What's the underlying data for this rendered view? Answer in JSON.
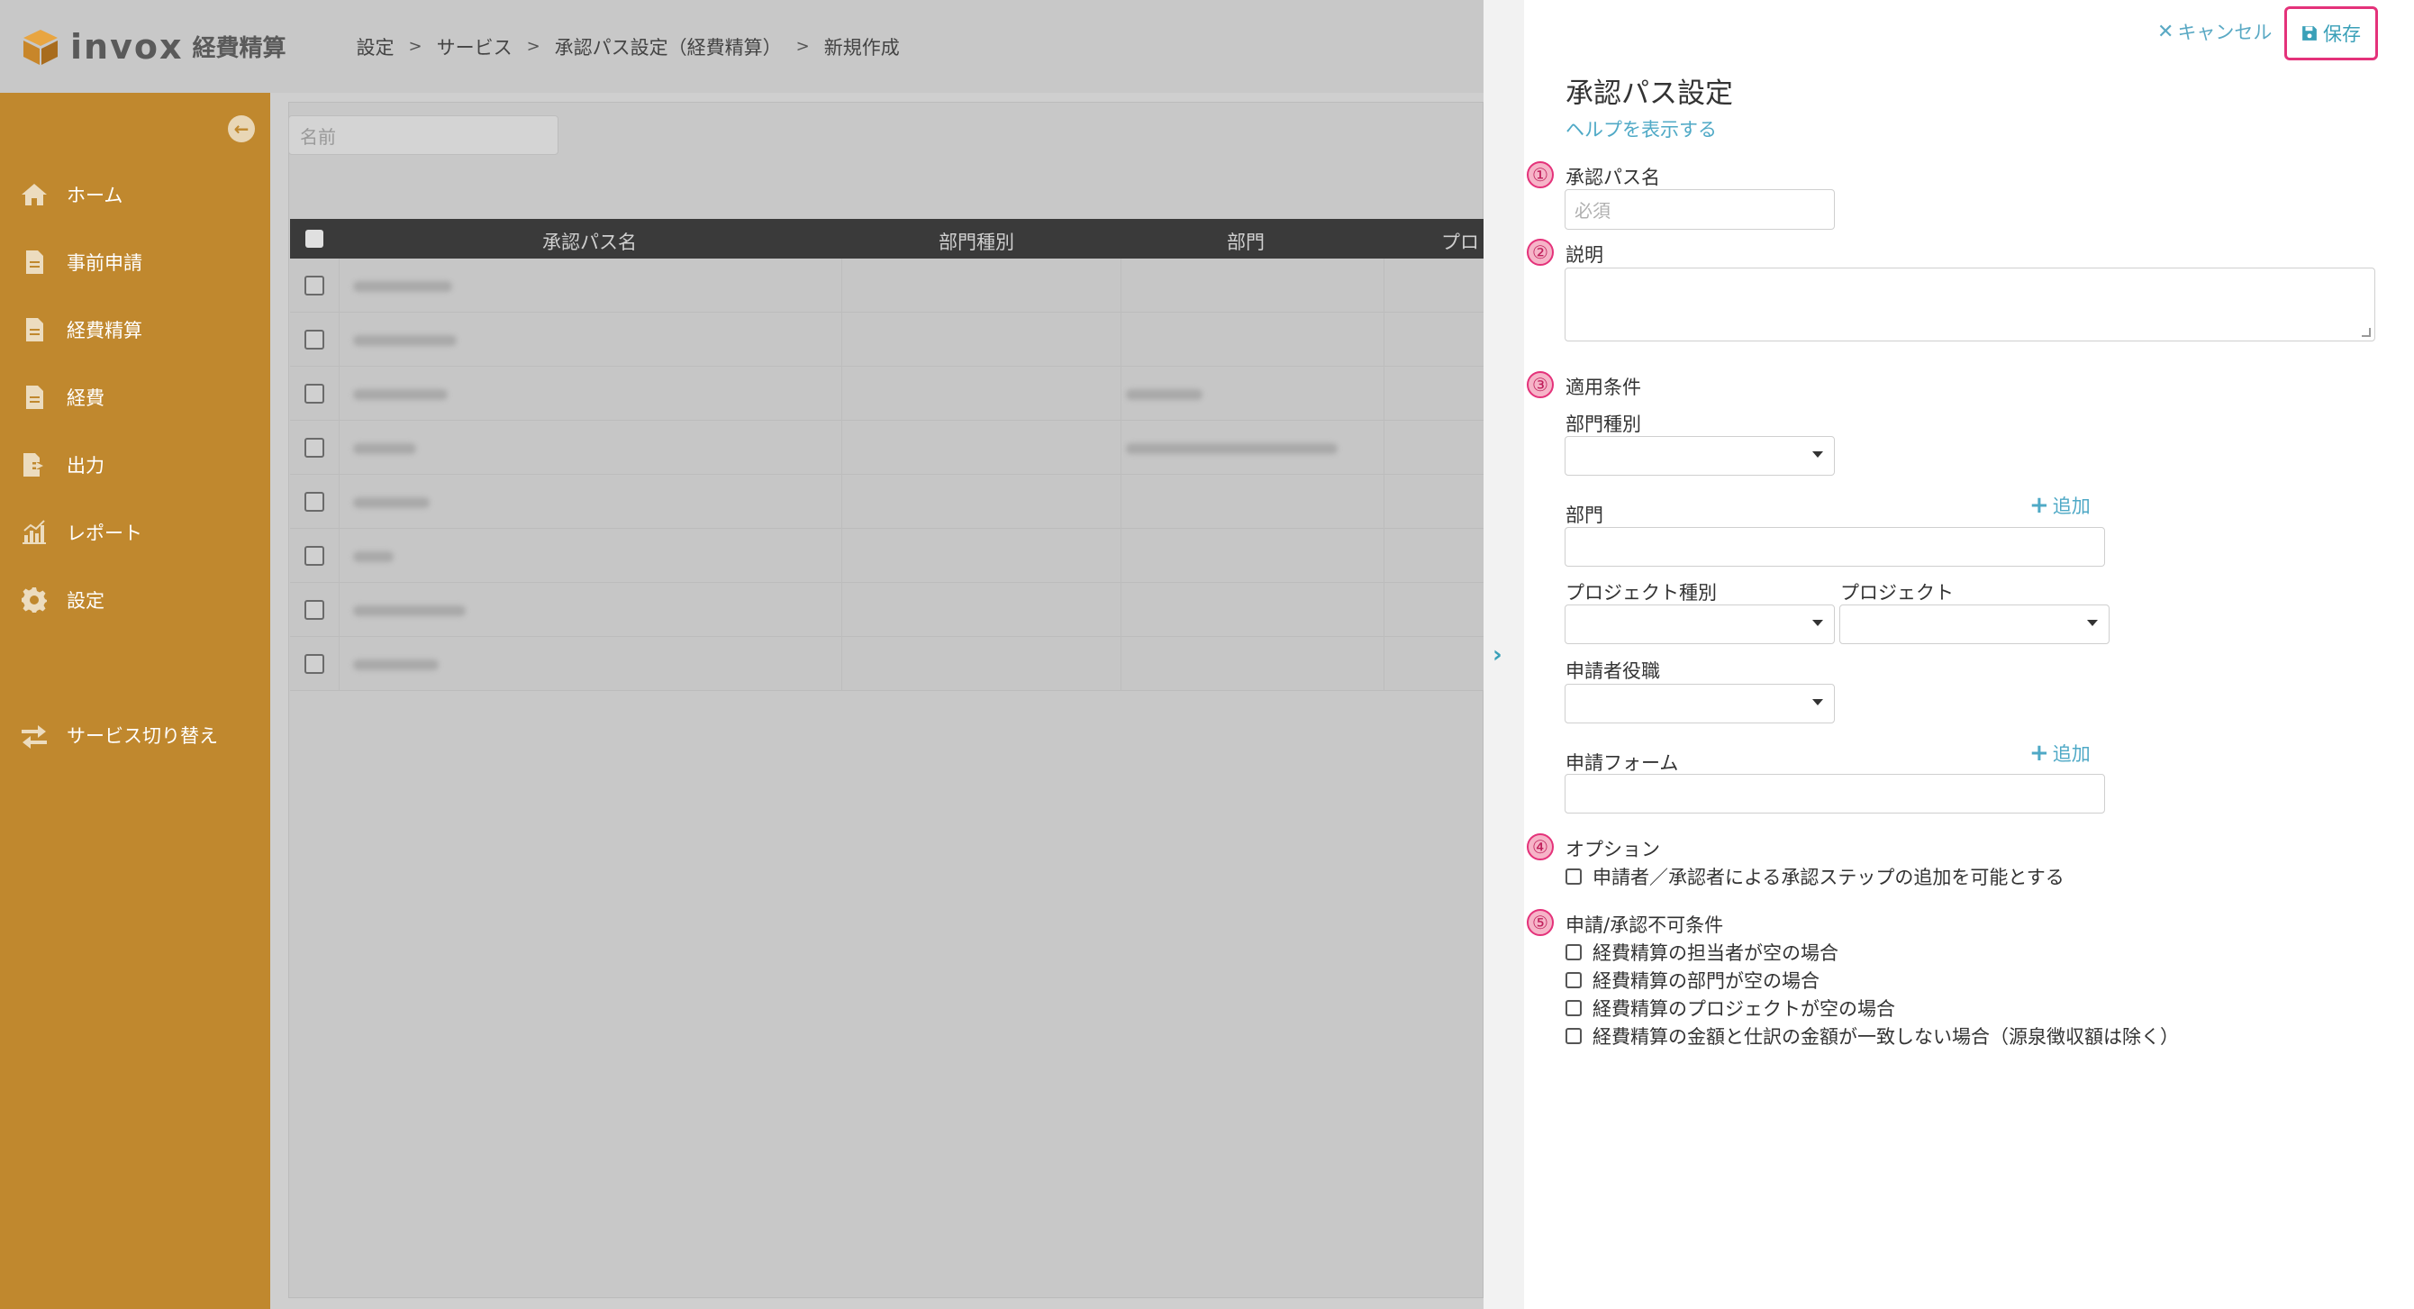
{
  "header": {
    "logo_text": "invox",
    "logo_sub": "経費精算",
    "breadcrumb": [
      "設定",
      "サービス",
      "承認パス設定（経費精算）",
      "新規作成"
    ]
  },
  "sidebar": {
    "items": [
      {
        "label": "ホーム",
        "icon": "home-icon"
      },
      {
        "label": "事前申請",
        "icon": "document-icon"
      },
      {
        "label": "経費精算",
        "icon": "document-icon"
      },
      {
        "label": "経費",
        "icon": "document-icon"
      },
      {
        "label": "出力",
        "icon": "export-icon"
      },
      {
        "label": "レポート",
        "icon": "chart-icon"
      },
      {
        "label": "設定",
        "icon": "gear-icon"
      }
    ],
    "switch_label": "サービス切り替え"
  },
  "main": {
    "name_placeholder": "名前",
    "columns": [
      "承認パス名",
      "部門種別",
      "部門",
      "プロジ"
    ]
  },
  "panel": {
    "cancel_label": "キャンセル",
    "save_label": "保存",
    "title": "承認パス設定",
    "help_link": "ヘルプを表示する",
    "section1": {
      "num": "①",
      "label": "承認パス名",
      "placeholder": "必須"
    },
    "section2": {
      "num": "②",
      "label": "説明"
    },
    "section3": {
      "num": "③",
      "label": "適用条件",
      "dept_type": "部門種別",
      "dept": "部門",
      "add": "追加",
      "project_type": "プロジェクト種別",
      "project": "プロジェクト",
      "applicant_role": "申請者役職",
      "form": "申請フォーム"
    },
    "section4": {
      "num": "④",
      "label": "オプション",
      "options": [
        "申請者／承認者による承認ステップの追加を可能とする"
      ]
    },
    "section5": {
      "num": "⑤",
      "label": "申請/承認不可条件",
      "options": [
        "経費精算の担当者が空の場合",
        "経費精算の部門が空の場合",
        "経費精算のプロジェクトが空の場合",
        "経費精算の金額と仕訳の金額が一致しない場合（源泉徴収額は除く）"
      ]
    }
  },
  "colors": {
    "sidebar": "#c0882e",
    "accent": "#4fa9c6",
    "highlight": "#e4327a"
  }
}
